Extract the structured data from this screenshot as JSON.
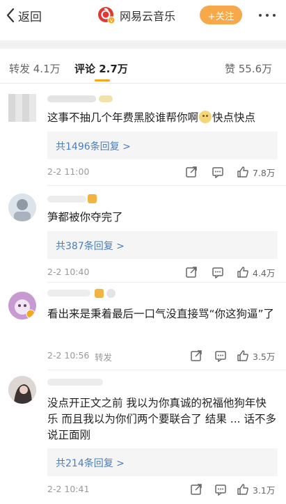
{
  "header": {
    "back_label": "返回",
    "brand_name": "网易云音乐",
    "follow_label": "+关注"
  },
  "tabs": [
    {
      "label": "转发 4.1万"
    },
    {
      "label": "评论 2.7万",
      "active": true
    },
    {
      "label": "赞 55.6万"
    }
  ],
  "colors": {
    "accent": "#f5a623",
    "follow_bg": "#f7a84a",
    "link": "#4a7ebb",
    "brand_red": "#dd3a34"
  },
  "comments": [
    {
      "text_before": "这事不抽几个年费黑胶谁帮你啊",
      "emoji": "smirk-emoji",
      "text_after": "快点快点",
      "reply": "共1496条回复 >",
      "time": "2-2 11:00",
      "likes": "7.8万"
    },
    {
      "text": "笋都被你夺完了",
      "reply": "共387条回复 >",
      "time": "2-2 10:40",
      "likes": "4.4万"
    },
    {
      "text": "看出来是秉着最后一口气没直接骂“你这狗逼”了",
      "time": "2-2 10:56",
      "repost": "转发",
      "likes": "3.5万"
    },
    {
      "text": "没点开正文之前 我以为你真诚的祝福他狗年快乐 而且我以为你们两个要联合了 结果 ... 话不多说正面刚",
      "reply": "共214条回复 >",
      "time": "2-2 10:41",
      "likes": "3.1万"
    }
  ]
}
